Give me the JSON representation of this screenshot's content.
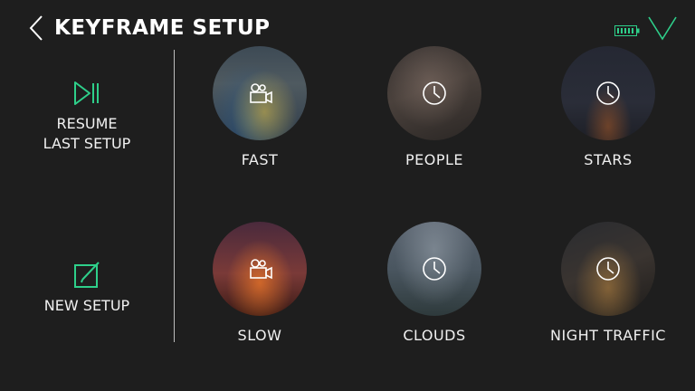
{
  "header": {
    "title": "KEYFRAME SETUP",
    "back_icon": "chevron-left-icon",
    "battery_icon": "battery-icon",
    "confirm_icon": "checkmark-icon"
  },
  "sidebar": {
    "resume": {
      "label": "RESUME\nLAST SETUP",
      "icon": "play-pause-icon"
    },
    "new_setup": {
      "label": "NEW SETUP",
      "icon": "edit-icon"
    }
  },
  "presets": [
    {
      "label": "FAST",
      "icon": "video-camera-icon"
    },
    {
      "label": "PEOPLE",
      "icon": "clock-icon"
    },
    {
      "label": "STARS",
      "icon": "clock-icon"
    },
    {
      "label": "SLOW",
      "icon": "video-camera-icon"
    },
    {
      "label": "CLOUDS",
      "icon": "clock-icon"
    },
    {
      "label": "NIGHT TRAFFIC",
      "icon": "clock-icon"
    }
  ],
  "colors": {
    "background": "#1e1e1e",
    "accent": "#2ecf8a",
    "text": "#ffffff"
  }
}
